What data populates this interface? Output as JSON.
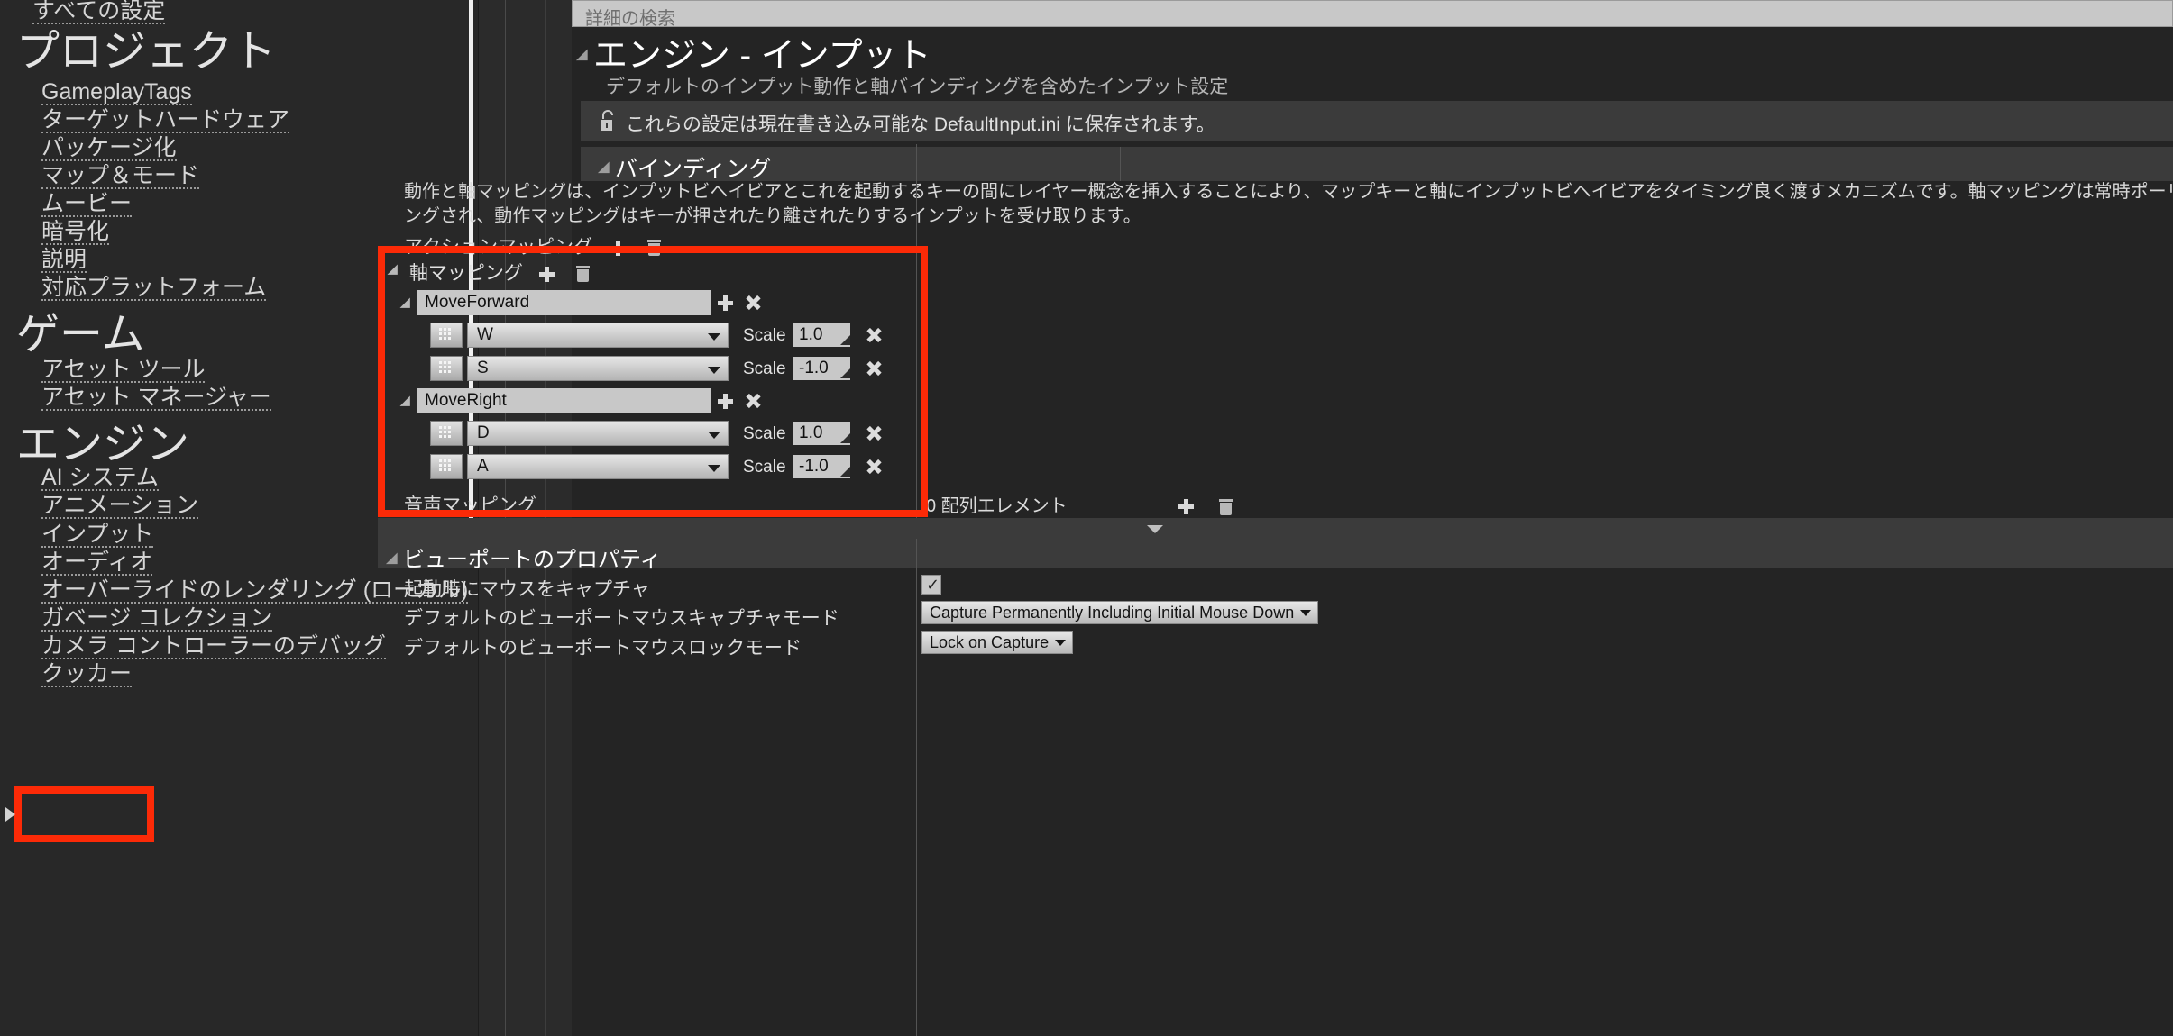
{
  "sidebar": {
    "top_link": "すべての設定",
    "sections": [
      {
        "heading": "プロジェクト",
        "items": [
          "GameplayTags",
          "ターゲットハードウェア",
          "パッケージ化",
          "マップ＆モード",
          "ムービー",
          "暗号化",
          "説明",
          "対応プラットフォーム"
        ]
      },
      {
        "heading": "ゲーム",
        "items": [
          "アセット ツール",
          "アセット マネージャー"
        ]
      },
      {
        "heading": "エンジン",
        "items": [
          "AI システム",
          "アニメーション",
          "インプット",
          "オーディオ",
          "オーバーライドのレンダリング (ローカル)",
          "ガベージ コレクション",
          "カメラ コントローラーのデバッグ",
          "クッカー"
        ]
      }
    ],
    "selected_item": "インプット"
  },
  "search": {
    "placeholder": "詳細の検索",
    "value": ""
  },
  "page": {
    "title": "エンジン - インプット",
    "subtitle": "デフォルトのインプット動作と軸バインディングを含めたインプット設定",
    "lock_notice": "これらの設定は現在書き込み可能な DefaultInput.ini に保存されます。"
  },
  "bindings": {
    "category_title": "バインディング",
    "description": "動作と軸マッピングは、インプットビヘイビアとこれを起動するキーの間にレイヤー概念を挿入することにより、マップキーと軸にインプットビヘイビアをタイミング良く渡すメカニズムです。軸マッピングは常時ポーリングされ、動作マッピングはキーが押されたり離されたりするインプットを受け取ります。",
    "action_mapping_label": "アクションマッピング",
    "axis_mapping_label": "軸マッピング",
    "voice_mapping_label": "音声マッピング",
    "array_elements_label": "0 配列エレメント",
    "scale_label": "Scale",
    "axis_mappings": [
      {
        "name": "MoveForward",
        "keys": [
          {
            "key": "W",
            "scale": "1.0"
          },
          {
            "key": "S",
            "scale": "-1.0"
          }
        ]
      },
      {
        "name": "MoveRight",
        "keys": [
          {
            "key": "D",
            "scale": "1.0"
          },
          {
            "key": "A",
            "scale": "-1.0"
          }
        ]
      }
    ]
  },
  "viewport": {
    "category_title": "ビューポートのプロパティ",
    "rows": [
      {
        "label": "起動時にマウスをキャプチャ",
        "type": "checkbox",
        "checked": true,
        "check_glyph": "✓"
      },
      {
        "label": "デフォルトのビューポートマウスキャプチャモード",
        "type": "combo",
        "value": "Capture Permanently Including Initial Mouse Down"
      },
      {
        "label": "デフォルトのビューポートマウスロックモード",
        "type": "combo",
        "value": "Lock on Capture"
      }
    ]
  },
  "colors": {
    "highlight_red": "#fc2a07",
    "panel_bg": "#242424",
    "sidebar_bg": "#282828",
    "row_header_bg": "#3b3b3b"
  }
}
